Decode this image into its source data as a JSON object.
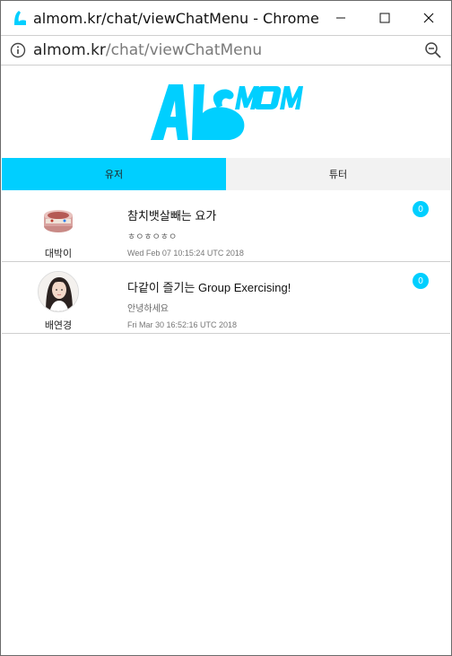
{
  "window": {
    "title": "almom.kr/chat/viewChatMenu - Chrome"
  },
  "address": {
    "domain": "almom.kr",
    "path": "/chat/viewChatMenu"
  },
  "colors": {
    "accent": "#00CFFF",
    "tab_inactive": "#F2F2F2"
  },
  "tabs": [
    {
      "label": "유저",
      "active": true
    },
    {
      "label": "튜터",
      "active": false
    }
  ],
  "chats": [
    {
      "user": "대박이",
      "title": "참치뱃살빼는 요가",
      "last_message": "ㅎㅇㅎㅇㅎㅇ",
      "time": "Wed Feb 07 10:15:24 UTC 2018",
      "unread": "0",
      "avatar_icon": "food-can-avatar"
    },
    {
      "user": "배연경",
      "title": "다같이 즐기는 Group Exercising!",
      "last_message": "안녕하세요",
      "time": "Fri Mar 30 16:52:16 UTC 2018",
      "unread": "0",
      "avatar_icon": "portrait-avatar"
    }
  ]
}
